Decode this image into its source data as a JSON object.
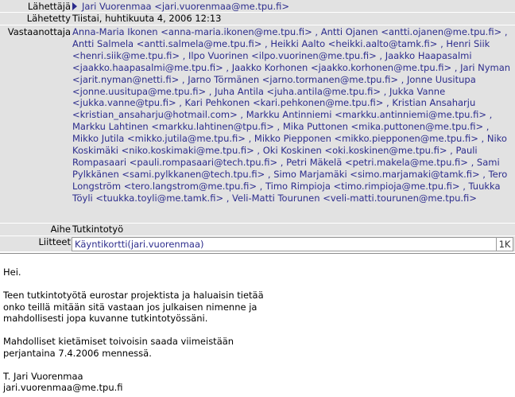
{
  "headers": {
    "from_label": "Lähettäjä",
    "from_value": "Jari Vuorenmaa <jari.vuorenmaa@me.tpu.fi>",
    "sent_label": "Lähetetty",
    "sent_value": "Tiistai, huhtikuuta 4, 2006 12:13",
    "to_label": "Vastaanottaja",
    "recipients": [
      "Anna-Maria Ikonen <anna-maria.ikonen@me.tpu.fi>",
      "Antti Ojanen <antti.ojanen@me.tpu.fi>",
      "Antti Salmela <antti.salmela@me.tpu.fi>",
      "Heikki Aalto <heikki.aalto@tamk.fi>",
      "Henri Siik <henri.siik@me.tpu.fi>",
      "Ilpo Vuorinen <ilpo.vuorinen@me.tpu.fi>",
      "Jaakko Haapasalmi <jaakko.haapasalmi@me.tpu.fi>",
      "Jaakko Korhonen <jaakko.korhonen@me.tpu.fi>",
      "Jari Nyman <jarit.nyman@netti.fi>",
      "Jarno Törmänen <jarno.tormanen@me.tpu.fi>",
      "Jonne Uusitupa <jonne.uusitupa@me.tpu.fi>",
      "Juha Antila <juha.antila@me.tpu.fi>",
      "Jukka Vanne <jukka.vanne@tpu.fi>",
      "Kari Pehkonen <kari.pehkonen@me.tpu.fi>",
      "Kristian Ansaharju <kristian_ansaharju@hotmail.com>",
      "Markku Antinniemi <markku.antinniemi@me.tpu.fi>",
      "Markku Lahtinen <markku.lahtinen@tpu.fi>",
      "Mika Puttonen <mika.puttonen@me.tpu.fi>",
      "Mikko Jutila <mikko.jutila@me.tpu.fi>",
      "Mikko Piepponen <mikko.piepponen@me.tpu.fi>",
      "Niko Koskimäki <niko.koskimaki@me.tpu.fi>",
      "Oki Koskinen <oki.koskinen@me.tpu.fi>",
      "Pauli Rompasaari <pauli.rompasaari@tech.tpu.fi>",
      "Petri Mäkelä <petri.makela@me.tpu.fi>",
      "Sami Pylkkänen <sami.pylkkanen@tech.tpu.fi>",
      "Simo Marjamäki <simo.marjamaki@tamk.fi>",
      "Tero Longström <tero.langstrom@me.tpu.fi>",
      "Timo Rimpioja <timo.rimpioja@me.tpu.fi>",
      "Tuukka Töyli <tuukka.toyli@me.tamk.fi>",
      "Veli-Matti Tourunen <veli-matti.tourunen@me.tpu.fi>"
    ],
    "subject_label": "Aihe",
    "subject_value": "Tutkintotyö",
    "attach_label": "Liitteet",
    "attach_name": "Käyntikortti(jari.vuorenmaa)",
    "attach_size": "1K"
  },
  "body_text": "Hei.\n\nTeen tutkintotyötä eurostar projektista ja haluaisin tietää\nonko teillä mitään sitä vastaan jos julkaisen nimenne ja\nmahdollisesti jopa kuvanne tutkintotyössäni.\n\nMahdolliset kietämiset toivoisin saada viimeistään\nperjantaina 7.4.2006 mennessä.\n\nT. Jari Vuorenmaa\njari.vuorenmaa@me.tpu.fi"
}
